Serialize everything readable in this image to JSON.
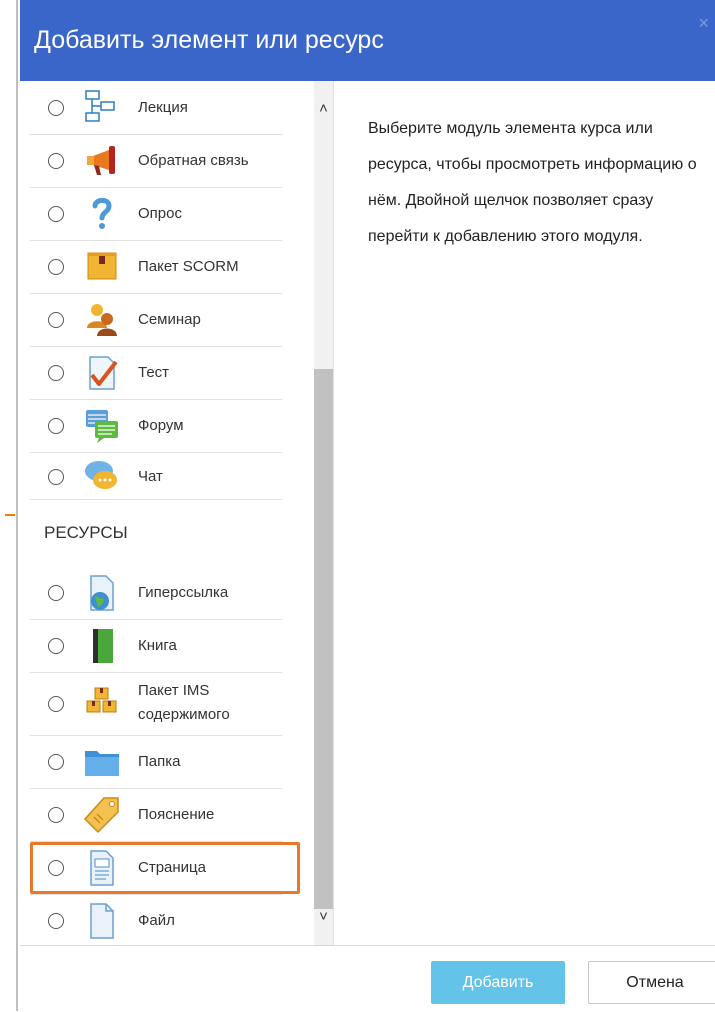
{
  "dialog": {
    "title": "Добавить элемент или ресурс",
    "close_label": "×"
  },
  "activities": [
    {
      "label": "Лекция",
      "icon": "lesson-icon"
    },
    {
      "label": "Обратная связь",
      "icon": "feedback-megaphone-icon"
    },
    {
      "label": "Опрос",
      "icon": "question-icon"
    },
    {
      "label": "Пакет SCORM",
      "icon": "scorm-package-icon"
    },
    {
      "label": "Семинар",
      "icon": "workshop-icon"
    },
    {
      "label": "Тест",
      "icon": "quiz-icon"
    },
    {
      "label": "Форум",
      "icon": "forum-icon"
    },
    {
      "label": "Чат",
      "icon": "chat-icon"
    }
  ],
  "resources_section_title": "РЕСУРСЫ",
  "resources": [
    {
      "label": "Гиперссылка",
      "icon": "url-icon"
    },
    {
      "label": "Книга",
      "icon": "book-icon"
    },
    {
      "label": "Пакет IMS содержимого",
      "label_line1": "Пакет IMS",
      "label_line2": "содержимого",
      "icon": "ims-package-icon"
    },
    {
      "label": "Папка",
      "icon": "folder-icon"
    },
    {
      "label": "Пояснение",
      "icon": "label-tag-icon"
    },
    {
      "label": "Страница",
      "icon": "page-icon"
    },
    {
      "label": "Файл",
      "icon": "file-icon"
    }
  ],
  "description": "Выберите модуль элемента курса или ресурса, чтобы просмотреть информацию о нём. Двойной щелчок позволяет сразу перейти к добавлению этого модуля.",
  "footer": {
    "add_label": "Добавить",
    "cancel_label": "Отмена"
  },
  "colors": {
    "header": "#3a65c9",
    "highlight": "#e8782a",
    "add_button": "#63c3e8"
  }
}
